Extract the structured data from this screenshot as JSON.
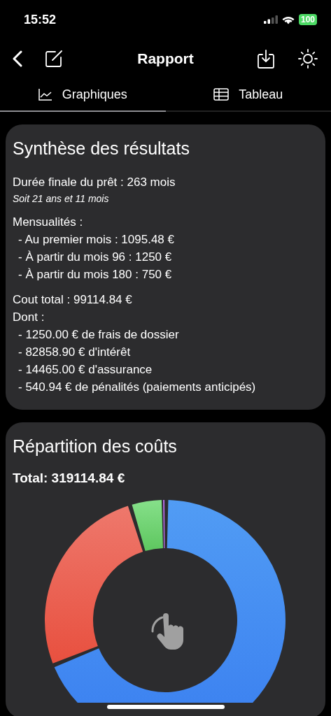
{
  "status_bar": {
    "time": "15:52",
    "battery": "100"
  },
  "nav": {
    "title": "Rapport"
  },
  "tabs": [
    {
      "label": "Graphiques",
      "kind": "chart",
      "selected": true
    },
    {
      "label": "Tableau",
      "kind": "table",
      "selected": false
    }
  ],
  "summary": {
    "title": "Synthèse des résultats",
    "groups": [
      [
        {
          "kind": "line",
          "text": "Durée finale du prêt : 263 mois"
        },
        {
          "kind": "note",
          "text": "Soit 21 ans et 11 mois"
        }
      ],
      [
        {
          "kind": "line",
          "text": "Mensualités :"
        },
        {
          "kind": "item",
          "text": "- Au premier mois : 1095.48 €"
        },
        {
          "kind": "item",
          "text": "- À partir du mois 96 : 1250 €"
        },
        {
          "kind": "item",
          "text": "- À partir du mois 180 : 750 €"
        }
      ],
      [
        {
          "kind": "line",
          "text": "Cout total : 99114.84 €"
        },
        {
          "kind": "line",
          "text": "Dont :"
        },
        {
          "kind": "item",
          "text": "- 1250.00 € de frais de dossier"
        },
        {
          "kind": "item",
          "text": "- 82858.90 € d'intérêt"
        },
        {
          "kind": "item",
          "text": "- 14465.00 € d'assurance"
        },
        {
          "kind": "item",
          "text": "- 540.94 € de pénalités (paiements anticipés)"
        }
      ]
    ]
  },
  "breakdown": {
    "title": "Répartition des coûts",
    "total": "Total: 319114.84 €"
  }
}
